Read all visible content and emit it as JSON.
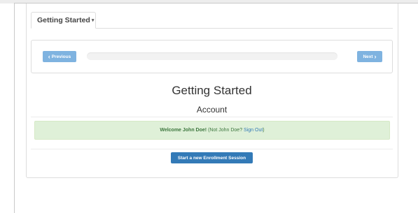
{
  "tab": {
    "label": "Getting Started",
    "caret": "▾"
  },
  "wizard": {
    "previous_label": "Previous",
    "previous_icon": "‹",
    "next_label": "Next",
    "next_icon": "›",
    "progress": 0
  },
  "main": {
    "title": "Getting Started",
    "subtitle": "Account"
  },
  "alert": {
    "welcome": "Welcome John Doe!",
    "not_user_prefix": " (Not John Doe? ",
    "sign_out": "Sign Out",
    "not_user_suffix": ")"
  },
  "actions": {
    "start_label": "Start a new Enrollment Session"
  },
  "colors": {
    "button_light": "#7fb3e0",
    "primary": "#337ab7",
    "alert_bg": "#dff0d8",
    "alert_text": "#3c763d"
  }
}
